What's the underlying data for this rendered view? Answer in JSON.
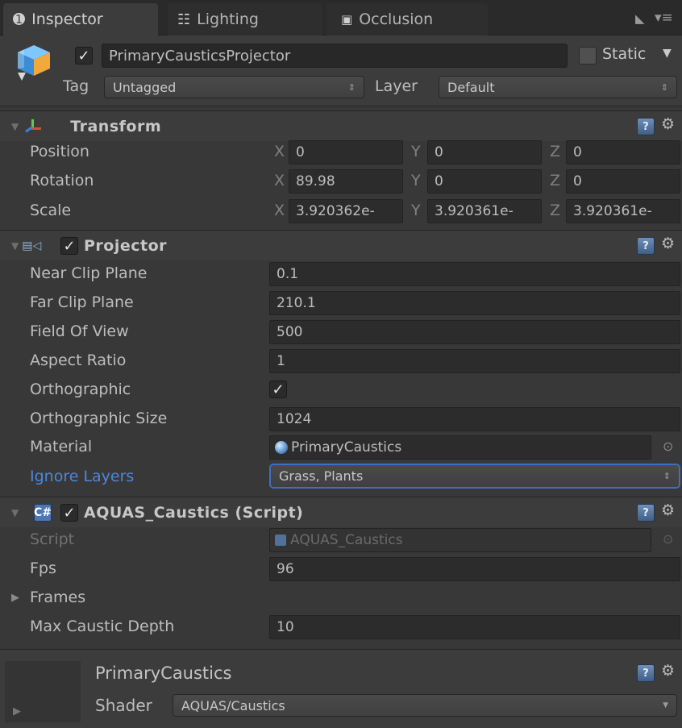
{
  "tabs": [
    {
      "label": "Inspector",
      "icon": "info-icon"
    },
    {
      "label": "Lighting",
      "icon": "lighting-icon"
    },
    {
      "label": "Occlusion",
      "icon": "occlusion-icon"
    }
  ],
  "header": {
    "object_name": "PrimaryCausticsProjector",
    "active": true,
    "static_label": "Static",
    "static_checked": false,
    "tag_label": "Tag",
    "tag_value": "Untagged",
    "layer_label": "Layer",
    "layer_value": "Default"
  },
  "transform": {
    "title": "Transform",
    "rows": [
      {
        "label": "Position",
        "x": "0",
        "y": "0",
        "z": "0"
      },
      {
        "label": "Rotation",
        "x": "89.98",
        "y": "0",
        "z": "0"
      },
      {
        "label": "Scale",
        "x": "3.920362e-",
        "y": "3.920361e-",
        "z": "3.920361e-"
      }
    ],
    "axis_labels": [
      "X",
      "Y",
      "Z"
    ]
  },
  "projector": {
    "title": "Projector",
    "enabled": true,
    "near_clip_label": "Near Clip Plane",
    "near_clip": "0.1",
    "far_clip_label": "Far Clip Plane",
    "far_clip": "210.1",
    "fov_label": "Field Of View",
    "fov": "500",
    "aspect_label": "Aspect Ratio",
    "aspect": "1",
    "ortho_label": "Orthographic",
    "ortho_checked": true,
    "ortho_size_label": "Orthographic Size",
    "ortho_size": "1024",
    "material_label": "Material",
    "material": "PrimaryCaustics",
    "ignore_label": "Ignore Layers",
    "ignore_value": "Grass, Plants"
  },
  "script_comp": {
    "title": "AQUAS_Caustics (Script)",
    "enabled": true,
    "script_label": "Script",
    "script_value": "AQUAS_Caustics",
    "fps_label": "Fps",
    "fps": "96",
    "frames_label": "Frames",
    "max_depth_label": "Max Caustic Depth",
    "max_depth": "10"
  },
  "material_panel": {
    "name": "PrimaryCaustics",
    "shader_label": "Shader",
    "shader_value": "AQUAS/Caustics"
  },
  "colors": {
    "background": "#383838",
    "accent_blue": "#4d86e0"
  }
}
